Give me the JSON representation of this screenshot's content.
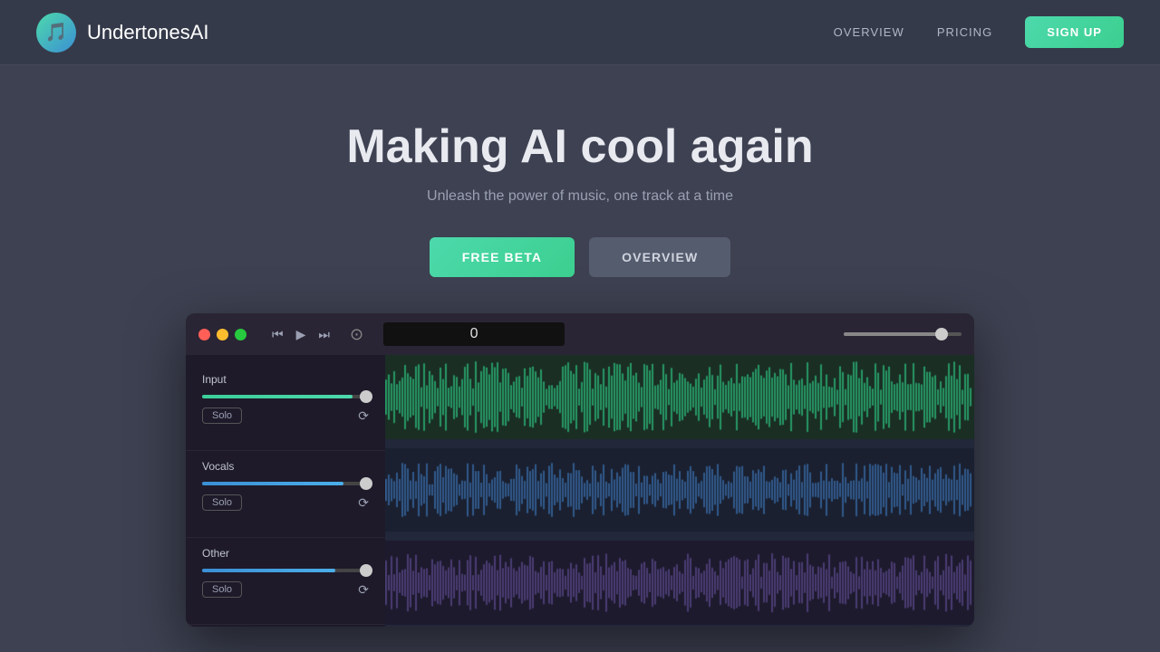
{
  "header": {
    "logo_text": "UndertonesAI",
    "logo_icon": "🎵",
    "nav": [
      {
        "label": "OVERVIEW",
        "id": "nav-overview"
      },
      {
        "label": "PRICING",
        "id": "nav-pricing"
      }
    ],
    "signup_label": "SIGN UP"
  },
  "hero": {
    "title": "Making AI cool again",
    "subtitle": "Unleash the power of music, one track at a time",
    "btn_free_beta": "FREE BETA",
    "btn_overview": "OVERVIEW"
  },
  "daw": {
    "timer_value": "0",
    "transport": {
      "rewind": "⏪",
      "play": "▶",
      "fast_forward": "⏩"
    },
    "tracks": [
      {
        "name": "Input",
        "fill_pct": 90,
        "fill_type": "green",
        "solo_label": "Solo",
        "waveform_type": "green"
      },
      {
        "name": "Vocals",
        "fill_pct": 85,
        "fill_type": "blue",
        "solo_label": "Solo",
        "waveform_type": "blue"
      },
      {
        "name": "Other",
        "fill_pct": 80,
        "fill_type": "blue",
        "solo_label": "Solo",
        "waveform_type": "purple"
      }
    ]
  }
}
